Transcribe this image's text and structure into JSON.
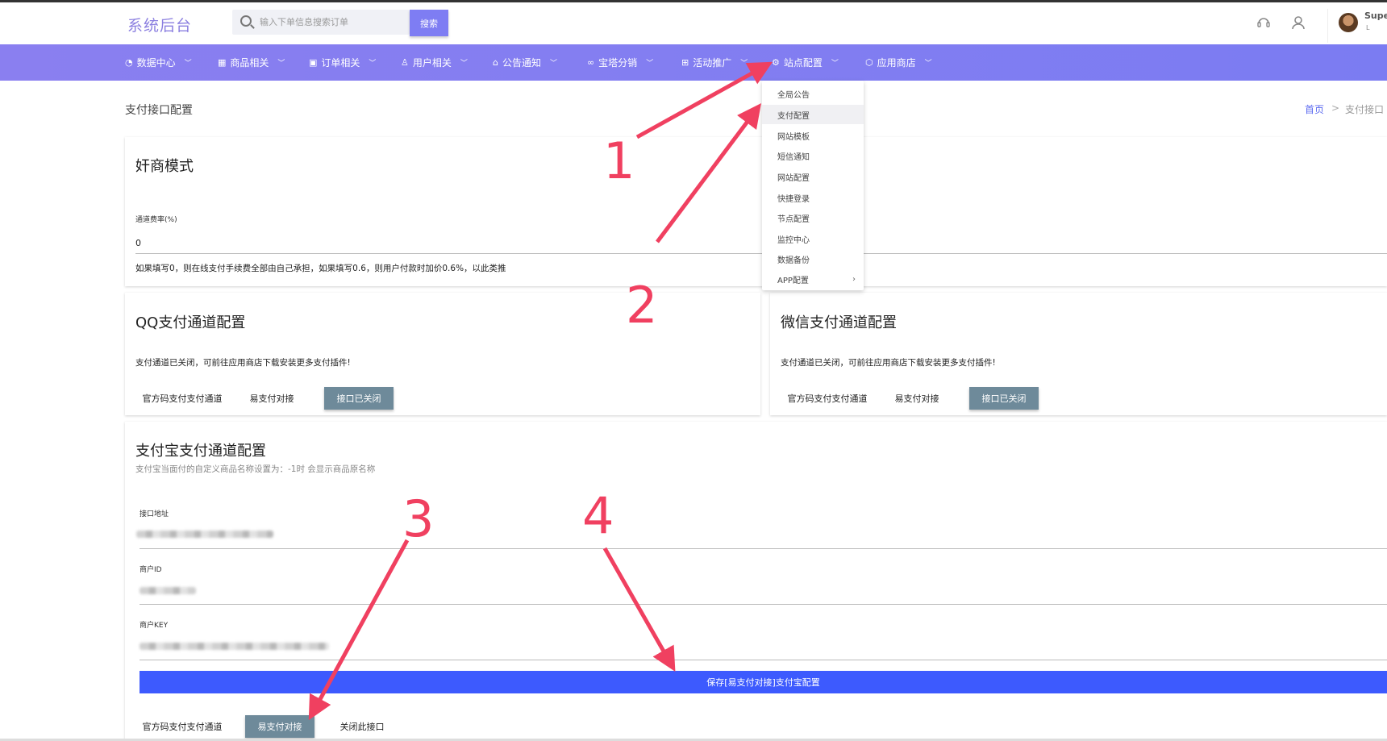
{
  "header": {
    "logo": "系统后台",
    "search_placeholder": "输入下单信息搜索订单",
    "search_button": "搜索",
    "user_name": "Supe",
    "user_role": "L"
  },
  "nav": {
    "items": [
      {
        "label": "数据中心",
        "icon": "dashboard-icon"
      },
      {
        "label": "商品相关",
        "icon": "grid-icon"
      },
      {
        "label": "订单相关",
        "icon": "order-icon"
      },
      {
        "label": "用户相关",
        "icon": "user-icon"
      },
      {
        "label": "公告通知",
        "icon": "notice-icon"
      },
      {
        "label": "宝塔分销",
        "icon": "share-icon"
      },
      {
        "label": "活动推广",
        "icon": "gift-icon"
      },
      {
        "label": "站点配置",
        "icon": "gear-icon"
      },
      {
        "label": "应用商店",
        "icon": "cube-icon"
      }
    ]
  },
  "dropdown": {
    "items": [
      "全局公告",
      "支付配置",
      "网站模板",
      "短信通知",
      "网站配置",
      "快捷登录",
      "节点配置",
      "监控中心",
      "数据备份",
      "APP配置"
    ],
    "active_index": 1
  },
  "page": {
    "title": "支付接口配置",
    "breadcrumb_home": "首页",
    "breadcrumb_sep": ">",
    "breadcrumb_current": "支付接口"
  },
  "merchant_card": {
    "title": "奸商模式",
    "rate_label": "通道费率(%)",
    "rate_value": "0",
    "help": "如果填写0，则在线支付手续费全部由自己承担，如果填写0.6，则用户付款时加价0.6%，以此类推"
  },
  "qq_card": {
    "title": "QQ支付通道配置",
    "notice": "支付通道已关闭，可前往应用商店下载安装更多支付插件!",
    "tabs": [
      "官方码支付支付通道",
      "易支付对接",
      "接口已关闭"
    ]
  },
  "wechat_card": {
    "title": "微信支付通道配置",
    "notice": "支付通道已关闭，可前往应用商店下载安装更多支付插件!",
    "tabs": [
      "官方码支付支付通道",
      "易支付对接",
      "接口已关闭"
    ]
  },
  "alipay_card": {
    "title": "支付宝支付通道配置",
    "subtitle": "支付宝当面付的自定义商品名称设置为：-1时 会显示商品原名称",
    "field_url_label": "接口地址",
    "field_mid_label": "商户ID",
    "field_key_label": "商户KEY",
    "save_button": "保存[易支付对接]支付宝配置",
    "tabs": [
      "官方码支付支付通道",
      "易支付对接",
      "关闭此接口"
    ]
  },
  "annotations": [
    "1",
    "2",
    "3",
    "4"
  ],
  "colors": {
    "nav_gradient_start": "#8a7ff0",
    "nav_gradient_end": "#7b7cf2",
    "search_button": "#7e7df3",
    "save_button": "#3d5afe",
    "active_tab": "#6e8a9a",
    "annotation_red": "#f04060"
  }
}
